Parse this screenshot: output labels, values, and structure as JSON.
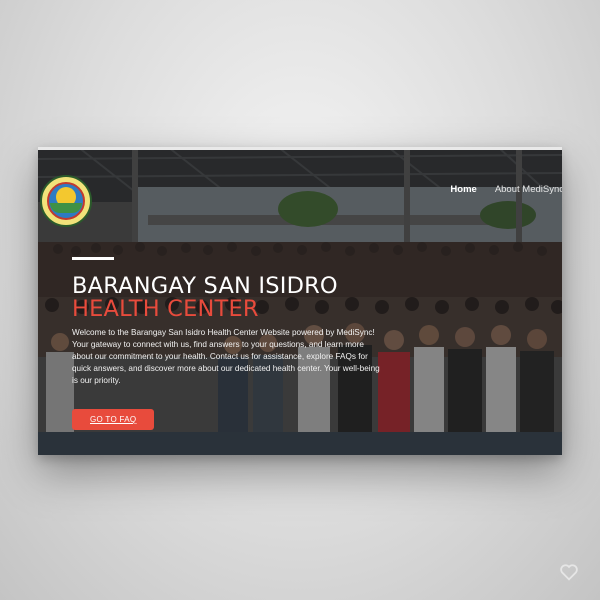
{
  "nav": {
    "items": [
      {
        "label": "Home",
        "active": true
      },
      {
        "label": "About MediSync",
        "active": false
      }
    ]
  },
  "hero": {
    "title_line1": "BARANGAY SAN ISIDRO",
    "title_line2": "HEALTH CENTER",
    "description": "Welcome to the Barangay San Isidro Health Center Website powered by MediSync! Your gateway to connect with us, find answers to your questions, and learn more about our commitment to your health. Contact us for assistance, explore FAQs for quick answers, and discover more about our dedicated health center. Your well-being is our priority.",
    "cta_label": "GO TO FAQ"
  },
  "colors": {
    "accent": "#e84b3c",
    "text": "#ffffff",
    "background": "#d9d9d9"
  },
  "icons": {
    "logo": "barangay-seal-logo",
    "watermark": "heart-icon"
  }
}
